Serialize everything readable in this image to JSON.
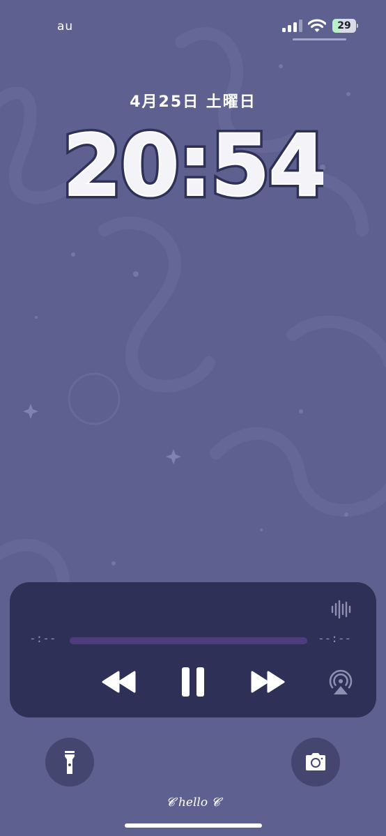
{
  "status_bar": {
    "carrier": "au",
    "battery": "29",
    "battery_level_percent": 29
  },
  "lock_screen": {
    "date": "4月25日 土曜日",
    "time": "20:54",
    "footer_text": "hello"
  },
  "now_playing": {
    "elapsed": "-:--",
    "remaining": "--:--",
    "progress_fraction": 0
  },
  "icons": {
    "wave": "waveform-icon",
    "rewind": "rewind-icon",
    "pause": "pause-icon",
    "forward": "fast-forward-icon",
    "airplay": "airplay-icon",
    "flashlight": "flashlight-icon",
    "camera": "camera-icon"
  },
  "colors": {
    "wallpaper": "#5e6190",
    "player_bg": "#2f3058",
    "track": "#4e3c7e",
    "button_bg": "#444670"
  }
}
